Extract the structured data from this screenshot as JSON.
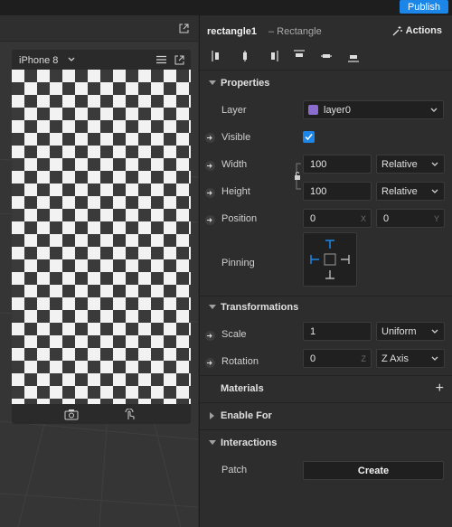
{
  "topbar": {
    "publish_label": "Publish"
  },
  "viewport": {
    "device": {
      "name": "iPhone 8"
    }
  },
  "inspector": {
    "object_name": "rectangle1",
    "object_type": "– Rectangle",
    "actions_label": "Actions",
    "sections": {
      "properties": "Properties",
      "transformations": "Transformations",
      "materials": "Materials",
      "enable_for": "Enable For",
      "interactions": "Interactions"
    },
    "properties": {
      "layer_label": "Layer",
      "layer_value": "layer0",
      "layer_color": "#8b6ccf",
      "visible_label": "Visible",
      "visible_checked": true,
      "width_label": "Width",
      "width_value": "100",
      "width_mode": "Relative",
      "height_label": "Height",
      "height_value": "100",
      "height_mode": "Relative",
      "position_label": "Position",
      "position_x": "0",
      "position_x_axis": "X",
      "position_y": "0",
      "position_y_axis": "Y",
      "pinning_label": "Pinning"
    },
    "transformations": {
      "scale_label": "Scale",
      "scale_value": "1",
      "scale_mode": "Uniform",
      "rotation_label": "Rotation",
      "rotation_value": "0",
      "rotation_axis_letter": "Z",
      "rotation_axis": "Z Axis"
    },
    "interactions": {
      "patch_label": "Patch",
      "create_label": "Create"
    }
  },
  "colors": {
    "accent": "#1b86e8",
    "panel": "#2d2d2d",
    "field": "#202020"
  }
}
